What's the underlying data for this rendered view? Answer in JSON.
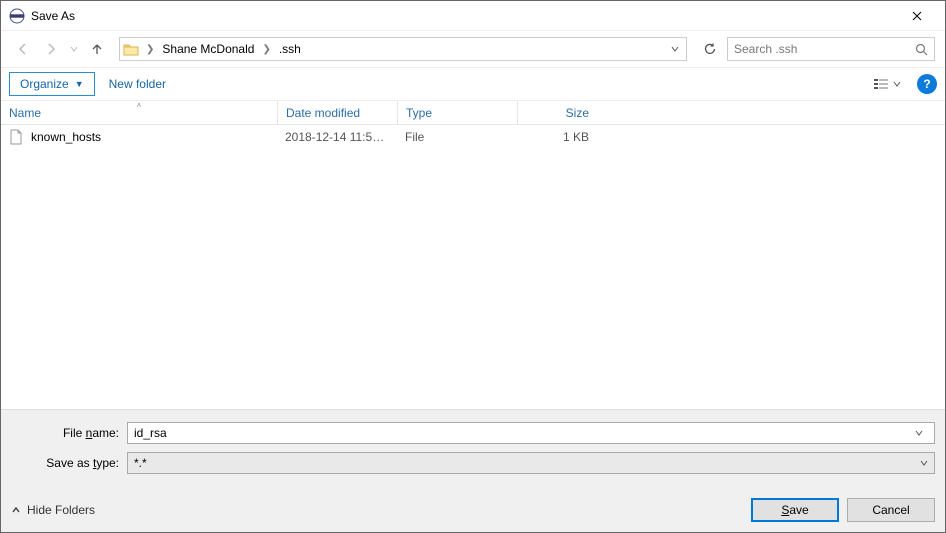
{
  "title": "Save As",
  "breadcrumb": {
    "seg1": "Shane McDonald",
    "seg2": ".ssh"
  },
  "search_placeholder": "Search .ssh",
  "toolbar": {
    "organize": "Organize",
    "new_folder": "New folder"
  },
  "columns": {
    "name": "Name",
    "date": "Date modified",
    "type": "Type",
    "size": "Size"
  },
  "files": [
    {
      "name": "known_hosts",
      "date": "2018-12-14 11:59 ...",
      "type": "File",
      "size": "1 KB"
    }
  ],
  "labels": {
    "file_name_pre": "File ",
    "file_name_u": "n",
    "file_name_post": "ame:",
    "save_type_pre": "Save as ",
    "save_type_u": "t",
    "save_type_post": "ype:",
    "hide_folders": "Hide Folders",
    "save_u": "S",
    "save_post": "ave",
    "cancel": "Cancel"
  },
  "values": {
    "file_name": "id_rsa",
    "save_type": "*.*"
  }
}
